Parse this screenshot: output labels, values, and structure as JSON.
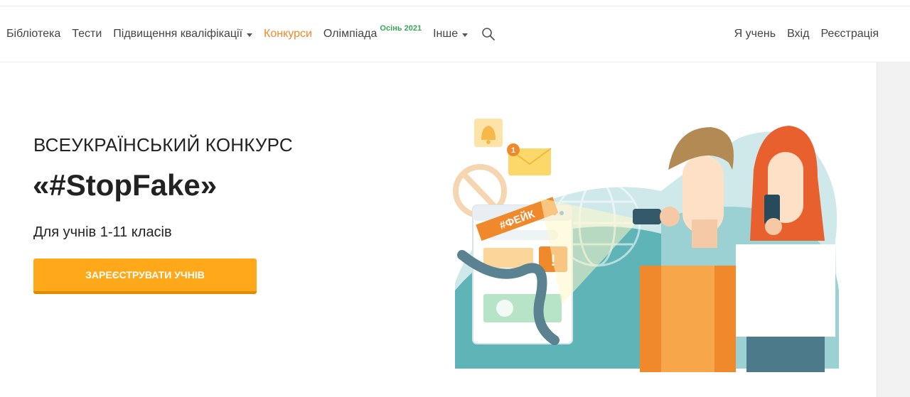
{
  "nav": {
    "items": [
      {
        "label": "Бібліотека",
        "dropdown": false,
        "active": false
      },
      {
        "label": "Тести",
        "dropdown": false,
        "active": false
      },
      {
        "label": "Підвищення кваліфікації",
        "dropdown": true,
        "active": false
      },
      {
        "label": "Конкурси",
        "dropdown": false,
        "active": true
      },
      {
        "label": "Олімпіада",
        "dropdown": false,
        "active": false,
        "badge": "Осінь 2021"
      },
      {
        "label": "Інше",
        "dropdown": true,
        "active": false
      }
    ],
    "right": [
      "Я учень",
      "Вхід",
      "Реєстрація"
    ],
    "active_color": "#f0892c",
    "badge_color": "#36a853"
  },
  "hero": {
    "subtitle": "ВСЕУКРАЇНСЬКИЙ КОНКУРС",
    "title": "«#StopFake»",
    "description": "Для учнів 1-11 класів",
    "cta_label": "ЗАРЕЄСТРУВАТИ УЧНІВ",
    "cta_color": "#ffa91a"
  },
  "illustration": {
    "tag_text": "#ФЕЙК",
    "notification_count": "1"
  }
}
